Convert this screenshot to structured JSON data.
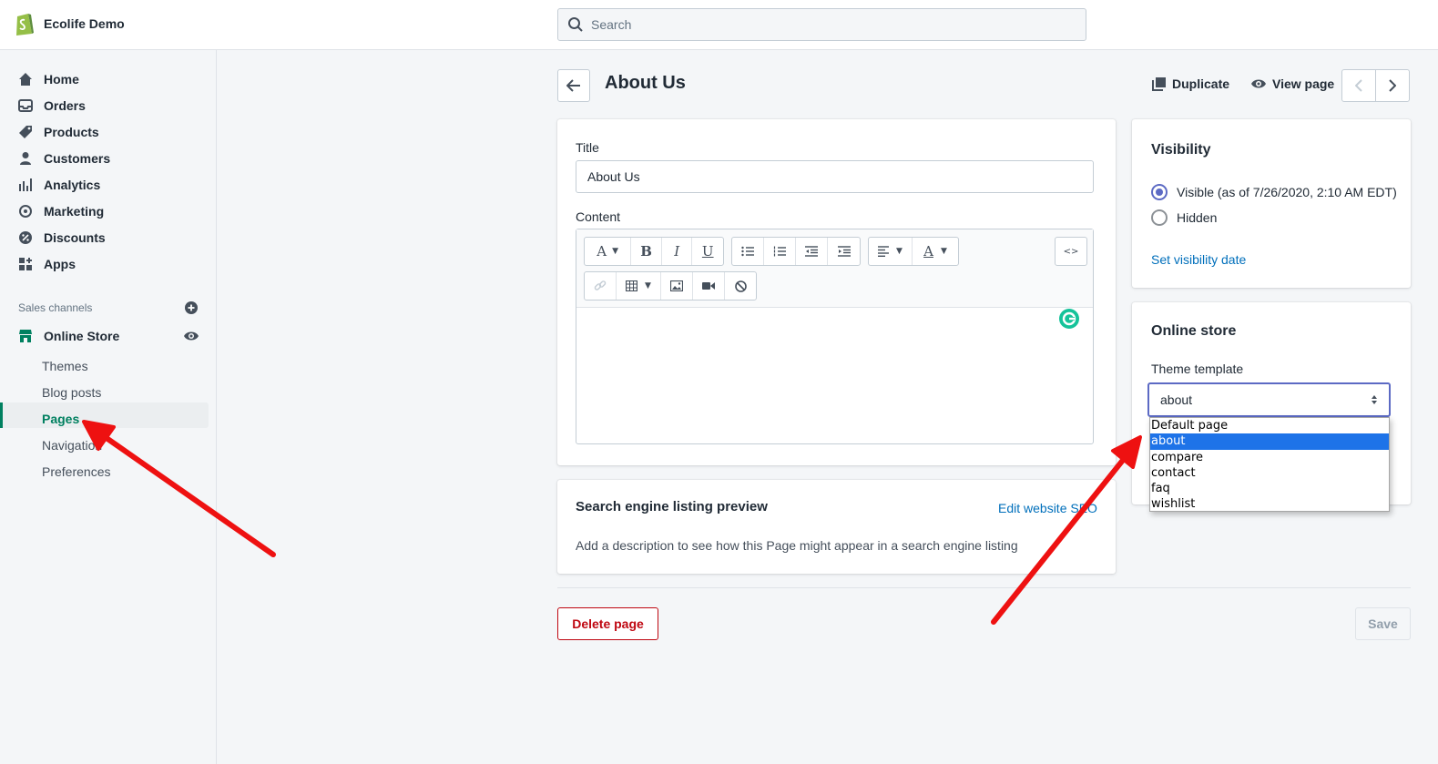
{
  "topbar": {
    "store_name": "Ecolife Demo",
    "search_placeholder": "Search"
  },
  "sidebar": {
    "items": [
      {
        "label": "Home",
        "icon": "home-icon"
      },
      {
        "label": "Orders",
        "icon": "orders-icon"
      },
      {
        "label": "Products",
        "icon": "tag-icon"
      },
      {
        "label": "Customers",
        "icon": "person-icon"
      },
      {
        "label": "Analytics",
        "icon": "bar-chart-icon"
      },
      {
        "label": "Marketing",
        "icon": "target-icon"
      },
      {
        "label": "Discounts",
        "icon": "discount-icon"
      },
      {
        "label": "Apps",
        "icon": "apps-icon"
      }
    ],
    "sales_channels_label": "Sales channels",
    "online_store_label": "Online Store",
    "sub_items": [
      "Themes",
      "Blog posts",
      "Pages",
      "Navigation",
      "Preferences"
    ],
    "active_sub_item": "Pages"
  },
  "header": {
    "title": "About Us",
    "duplicate_label": "Duplicate",
    "view_page_label": "View page"
  },
  "page_card": {
    "title_label": "Title",
    "title_value": "About Us",
    "content_label": "Content"
  },
  "seo_card": {
    "heading": "Search engine listing preview",
    "edit_link": "Edit website SEO",
    "description": "Add a description to see how this Page might appear in a search engine listing"
  },
  "visibility_card": {
    "heading": "Visibility",
    "visible_label": "Visible (as of 7/26/2020, 2:10 AM EDT)",
    "hidden_label": "Hidden",
    "set_date_link": "Set visibility date",
    "selected": "visible"
  },
  "online_store_card": {
    "heading": "Online store",
    "template_label": "Theme template",
    "template_value": "about",
    "options": [
      "Default page",
      "about",
      "compare",
      "contact",
      "faq",
      "wishlist"
    ],
    "selected_option": "about"
  },
  "footer": {
    "delete_label": "Delete page",
    "save_label": "Save"
  },
  "colors": {
    "accent": "#5c6ac4",
    "brand_green": "#008060",
    "danger": "#bf0711",
    "link": "#006fbb",
    "annotation_arrow": "#ee1111"
  }
}
